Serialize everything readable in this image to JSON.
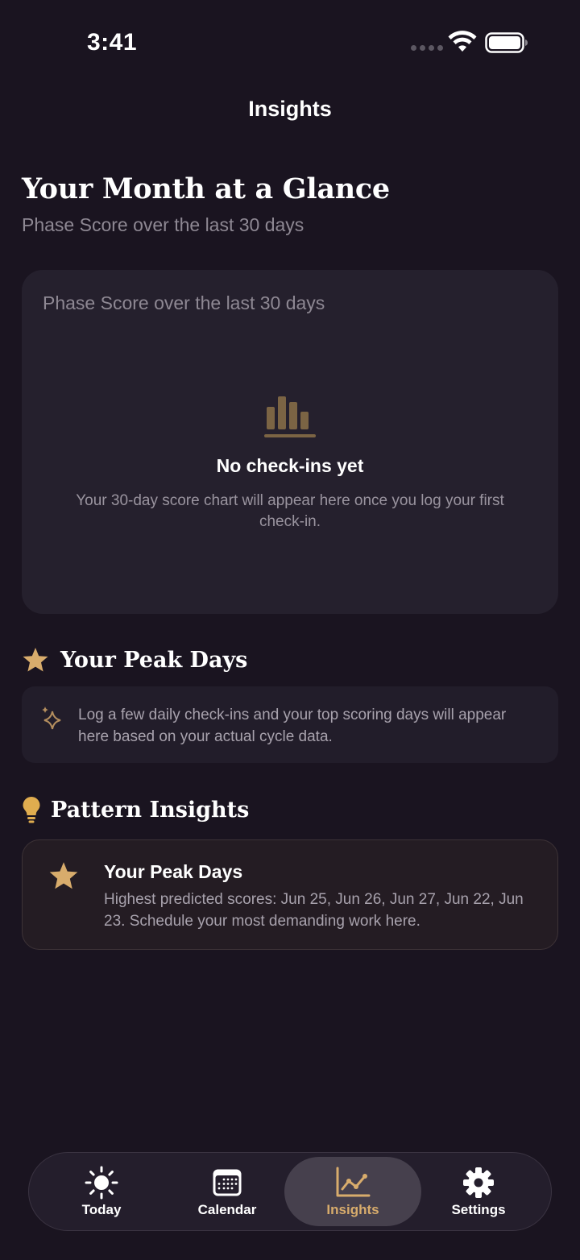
{
  "status_bar": {
    "time": "3:41"
  },
  "header": {
    "title": "Insights"
  },
  "month": {
    "title": "Your Month at a Glance",
    "subtitle": "Phase Score over the last 30 days"
  },
  "chart_card": {
    "title": "Phase Score over the last 30 days",
    "icon": "bar-chart-icon",
    "empty_title": "No check-ins yet",
    "empty_body": "Your 30-day score chart will appear here once you log your first check-in."
  },
  "peak_days": {
    "heading": "Your Peak Days",
    "icon": "star-icon",
    "card_icon": "sparkle-icon",
    "card_text": "Log a few daily check-ins and your top scoring days will appear here based on your actual cycle data."
  },
  "pattern_insights": {
    "heading": "Pattern Insights",
    "icon": "lightbulb-icon",
    "card": {
      "icon": "star-icon",
      "title": "Your Peak Days",
      "body": "Highest predicted scores: Jun 25, Jun 26, Jun 27, Jun 22, Jun 23. Schedule your most demanding work here."
    }
  },
  "tabs": [
    {
      "label": "Today",
      "icon": "sun-icon",
      "active": false
    },
    {
      "label": "Calendar",
      "icon": "calendar-icon",
      "active": false
    },
    {
      "label": "Insights",
      "icon": "chart-line-icon",
      "active": true
    },
    {
      "label": "Settings",
      "icon": "gear-icon",
      "active": false
    }
  ],
  "colors": {
    "background": "#1a1420",
    "card": "#25202d",
    "accent": "#d8ac6c",
    "muted_text": "#8e8893"
  }
}
